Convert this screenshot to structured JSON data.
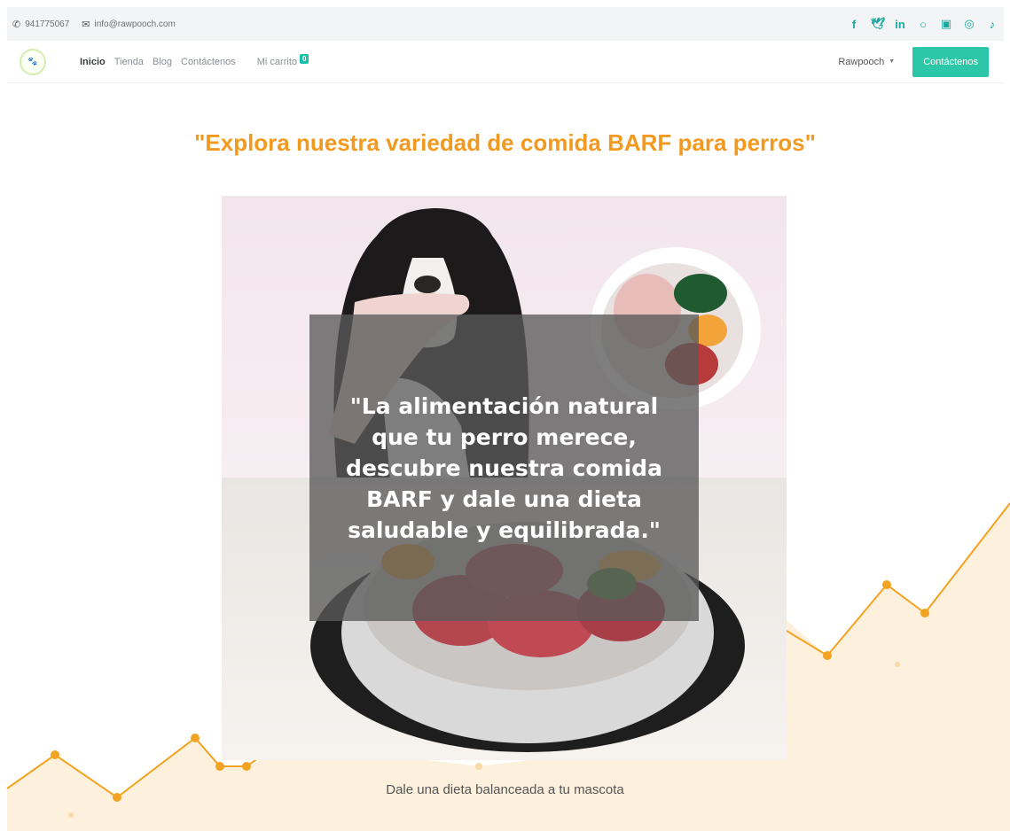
{
  "topbar": {
    "phone": "941775067",
    "email": "info@rawpooch.com",
    "socials": [
      "facebook-icon",
      "twitter-icon",
      "linkedin-icon",
      "github-icon",
      "youtube-icon",
      "instagram-icon",
      "tiktok-icon"
    ]
  },
  "navbar": {
    "links": [
      {
        "label": "Inicio"
      },
      {
        "label": "Tienda"
      },
      {
        "label": "Blog"
      },
      {
        "label": "Contáctenos"
      }
    ],
    "cart_label": "Mi carrito",
    "cart_count": "0",
    "dropdown_label": "Rawpooch",
    "cta_label": "Contáctenos"
  },
  "main": {
    "headline": "\"Explora nuestra variedad de comida BARF para perros\"",
    "overlay_text": "\"La alimentación natural que tu perro merece, descubre nuestra comida BARF y dale una dieta saludable y equilibrada.\"",
    "caption": "Dale una dieta balanceada a tu mascota"
  },
  "colors": {
    "accent_orange": "#f29a1f",
    "accent_teal": "#2cc7a8",
    "overlay_gray": "#5a5a5a"
  }
}
